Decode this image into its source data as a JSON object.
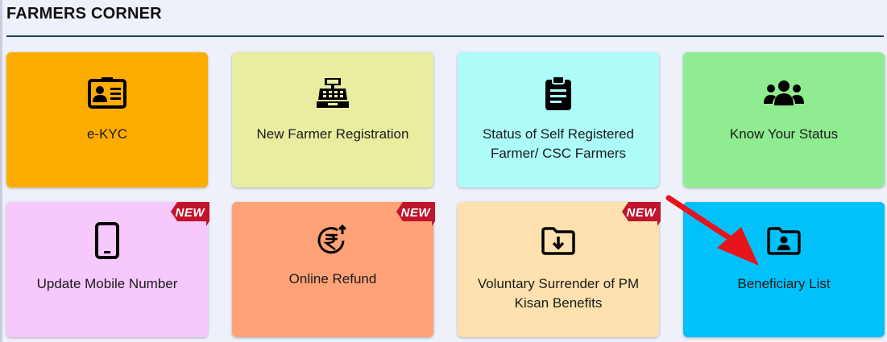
{
  "section": {
    "title": "FARMERS CORNER"
  },
  "tiles": [
    {
      "label": "e-KYC",
      "icon": "id-card-icon",
      "bg": "#ffac00",
      "new": false
    },
    {
      "label": "New Farmer Registration",
      "icon": "cash-register-icon",
      "bg": "#e9eda0",
      "new": false
    },
    {
      "label": "Status of Self Registered Farmer/ CSC Farmers",
      "icon": "clipboard-icon",
      "bg": "#adfcfa",
      "new": false
    },
    {
      "label": "Know Your Status",
      "icon": "users-icon",
      "bg": "#90ec90",
      "new": false
    },
    {
      "label": "Update Mobile Number",
      "icon": "mobile-phone-icon",
      "bg": "#f6c8fc",
      "new": true
    },
    {
      "label": "Online Refund",
      "icon": "rupee-refund-icon",
      "bg": "#ffa277",
      "new": true
    },
    {
      "label": "Voluntary Surrender of PM Kisan Benefits",
      "icon": "folder-download-icon",
      "bg": "#fee1ae",
      "new": true
    },
    {
      "label": "Beneficiary List",
      "icon": "folder-user-icon",
      "bg": "#00c1fa",
      "new": false
    }
  ],
  "badge": {
    "text": "NEW",
    "color": "#c0152d"
  },
  "colors": {
    "title_rule": "#1c3d6e",
    "arrow": "#e8141b"
  }
}
